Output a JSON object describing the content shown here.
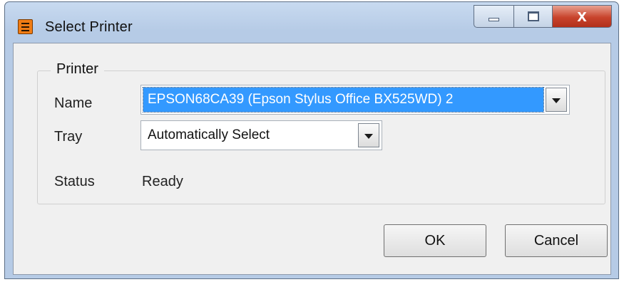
{
  "window": {
    "title": "Select Printer",
    "controls": {
      "minimize": "",
      "maximize": "",
      "close": "x"
    }
  },
  "printer_group": {
    "legend": "Printer",
    "name": {
      "label": "Name",
      "value": "EPSON68CA39 (Epson Stylus Office BX525WD) 2"
    },
    "tray": {
      "label": "Tray",
      "value": "Automatically Select"
    },
    "status": {
      "label": "Status",
      "value": "Ready"
    }
  },
  "buttons": {
    "ok": "OK",
    "cancel": "Cancel"
  },
  "colors": {
    "selection": "#3399ff",
    "app_icon": "#f07c14",
    "close_button": "#c8432c"
  }
}
